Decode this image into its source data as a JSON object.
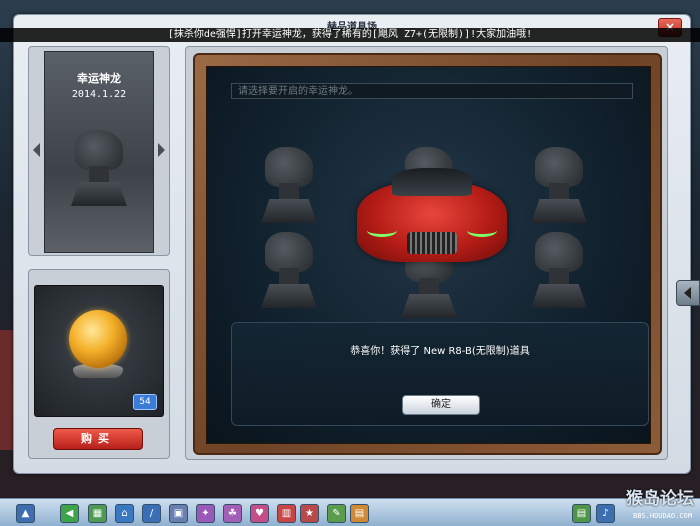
{
  "window": {
    "title": "赫品道具场",
    "close_label": "×"
  },
  "marquee": "[抹杀你de强悍]打开幸运神龙，获得了稀有的[飓风 Z7+(无限制)]!大家加油哦!",
  "item": {
    "name": "幸运神龙",
    "date": "2014.1.22"
  },
  "inventory": {
    "count": "54",
    "buy_label": "购买"
  },
  "stage": {
    "hint_placeholder": "请选择要开启的幸运神龙。",
    "message": "恭喜你！获得了 New R8-B(无限制)道具",
    "ok_label": "确定"
  },
  "taskbar": {
    "icons": [
      "back-icon",
      "shop-icon",
      "home-icon",
      "tools-icon",
      "gift-icon",
      "team-icon",
      "heart-icon",
      "book-icon",
      "stars-icon",
      "chat-icon",
      "photo-icon",
      "notes-icon",
      "sound-icon"
    ]
  },
  "watermark": {
    "text": "猴岛论坛",
    "sub": "BBS.HOUDAO.COM"
  },
  "colors": {
    "buy": "#d0281f",
    "badge": "#3b7bd8",
    "headlight": "#7dff6a"
  }
}
